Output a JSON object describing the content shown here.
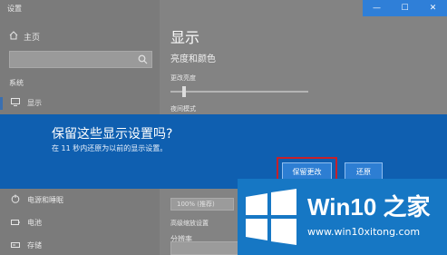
{
  "window": {
    "title": "设置",
    "controls": [
      "—",
      "☐",
      "✕"
    ]
  },
  "sidebar": {
    "home_label": "主页",
    "search_placeholder": "",
    "section_label": "系统",
    "selected_item": "显示",
    "items_bottom": [
      {
        "label": "电源和睡眠",
        "icon": "power-icon"
      },
      {
        "label": "电池",
        "icon": "battery-icon"
      },
      {
        "label": "存储",
        "icon": "storage-icon"
      }
    ]
  },
  "main": {
    "page_title": "显示",
    "sub_heading": "亮度和颜色",
    "brightness_label": "更改亮度",
    "brightness_level": 0.1,
    "night_mode_label": "夜间模式",
    "scale_value": "100% (推荐)",
    "advanced_label": "高级缩放设置",
    "resolution_label": "分辨率"
  },
  "dialog": {
    "title": "保留这些显示设置吗?",
    "message": "在 11 秒内还原为以前的显示设置。",
    "keep_button": "保留更改",
    "revert_button": "还原",
    "colors": {
      "band": "#0f5fb0",
      "highlight": "#c6202a"
    }
  },
  "watermark": {
    "brand": "Win10 之家",
    "url": "www.win10xitong.com",
    "color": "#1677c4"
  }
}
